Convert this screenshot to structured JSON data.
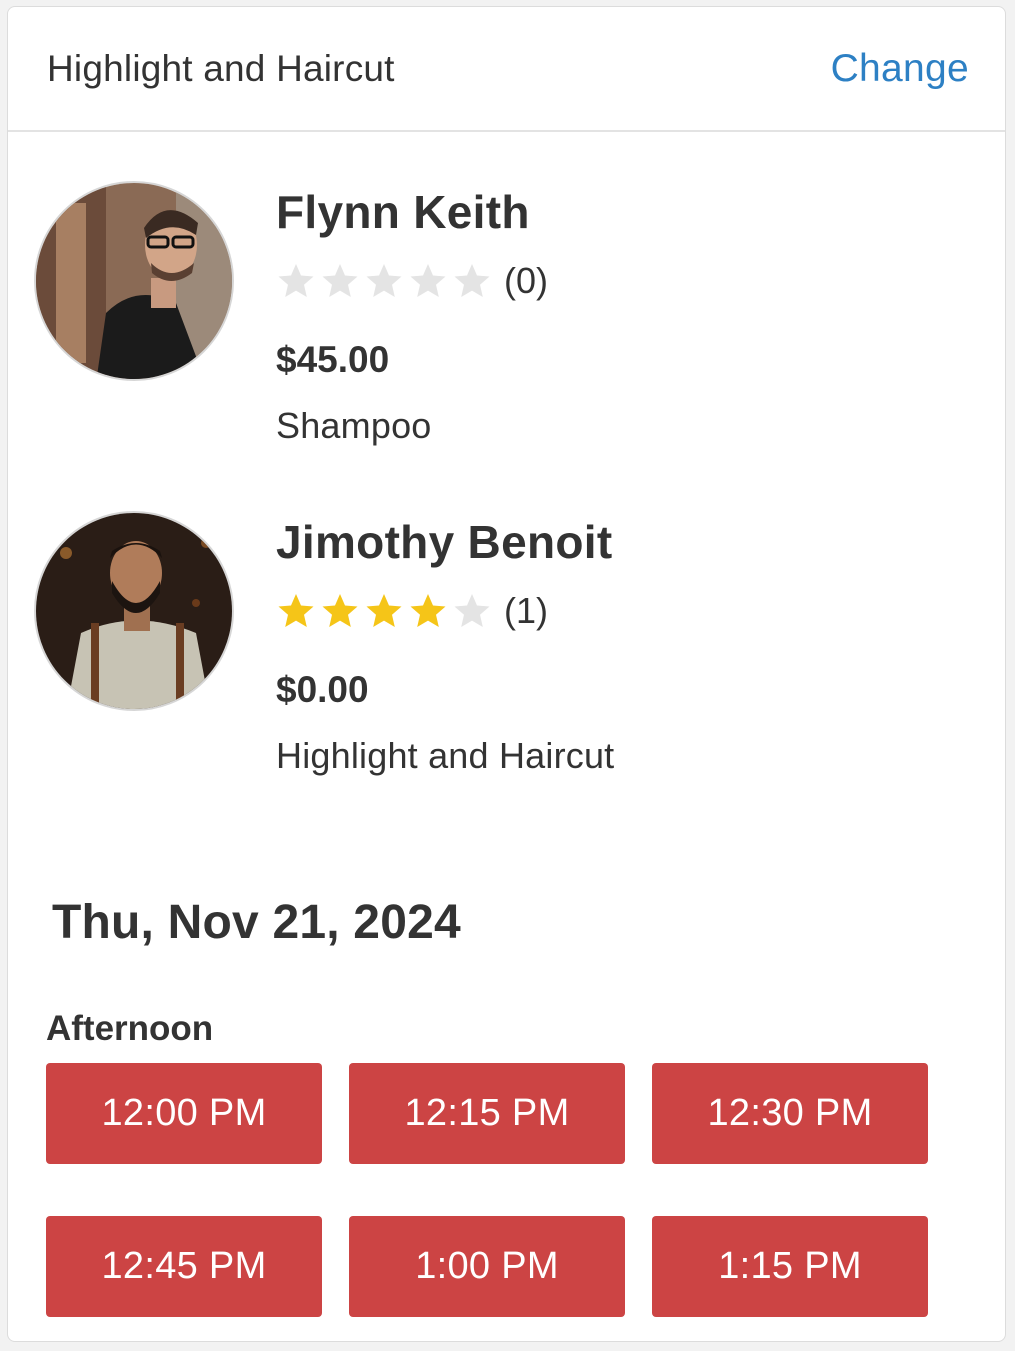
{
  "header": {
    "title": "Highlight and Haircut",
    "change_label": "Change"
  },
  "stylists": [
    {
      "name": "Flynn Keith",
      "rating": 0,
      "rating_count": "(0)",
      "price": "$45.00",
      "service": "Shampoo"
    },
    {
      "name": "Jimothy Benoit",
      "rating": 4,
      "rating_count": "(1)",
      "price": "$0.00",
      "service": "Highlight and Haircut"
    }
  ],
  "schedule": {
    "date": "Thu, Nov 21, 2024",
    "period": "Afternoon",
    "slots": [
      "12:00 PM",
      "12:15 PM",
      "12:30 PM",
      "12:45 PM",
      "1:00 PM",
      "1:15 PM"
    ]
  },
  "colors": {
    "accent_link": "#2d80c4",
    "slot_button": "#cc4444",
    "star_filled": "#f5c518",
    "star_empty": "#e4e4e4"
  },
  "icons": {
    "star": "star-icon"
  }
}
